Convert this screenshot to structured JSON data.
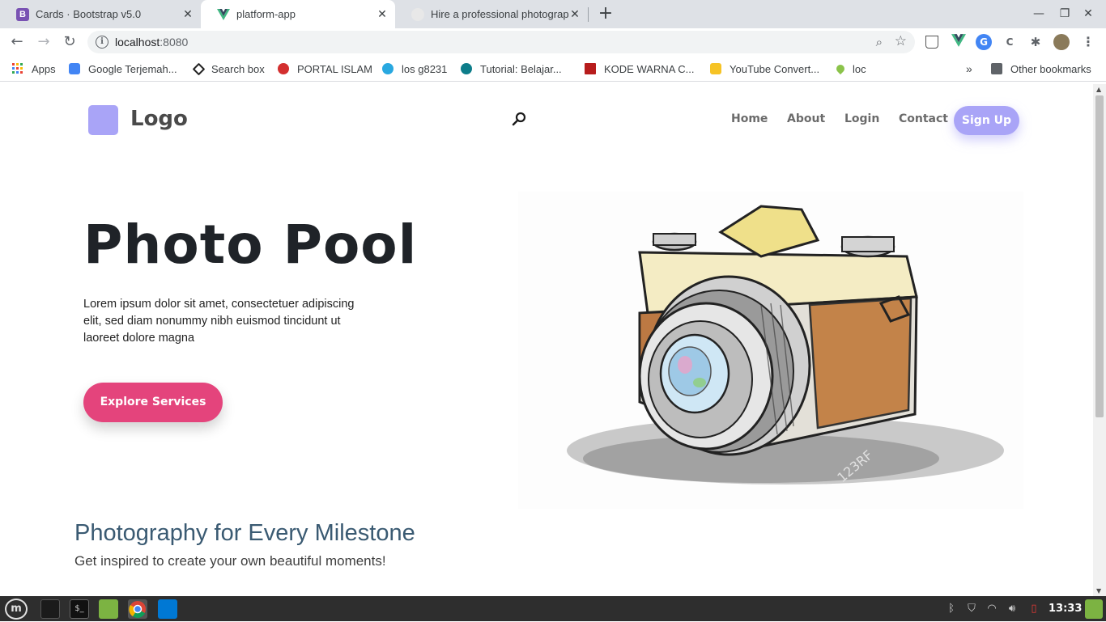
{
  "browser": {
    "tabs": [
      {
        "title": "Cards · Bootstrap v5.0",
        "favicon": "bootstrap-icon",
        "favicon_text": "B",
        "favicon_color": "#7952b3"
      },
      {
        "title": "platform-app",
        "favicon": "vue-icon",
        "active": true
      },
      {
        "title": "Hire a professional photographer",
        "favicon": "photographer-site-icon"
      }
    ],
    "new_tab_symbol": "+",
    "url_host": "localhost",
    "url_port": ":8080"
  },
  "bookmarks": [
    {
      "label": "Apps",
      "icon": "apps-grid-icon"
    },
    {
      "label": "Google Terjemah...",
      "icon": "google-translate-icon"
    },
    {
      "label": "Search box",
      "icon": "codepen-icon"
    },
    {
      "label": "PORTAL ISLAM",
      "icon": "portal-islam-icon"
    },
    {
      "label": "los g8231",
      "icon": "sf-icon"
    },
    {
      "label": "Tutorial: Belajar...",
      "icon": "tutorial-icon"
    },
    {
      "label": "KODE WARNA C...",
      "icon": "kode-warna-icon"
    },
    {
      "label": "YouTube Convert...",
      "icon": "youtube-convert-icon"
    },
    {
      "label": "loc",
      "icon": "location-icon"
    }
  ],
  "bookmarks_overflow": "»",
  "other_bookmarks": "Other bookmarks",
  "site": {
    "logo_text": "Logo",
    "nav": [
      "Home",
      "About",
      "Login",
      "Contact"
    ],
    "signup_label": "Sign Up",
    "hero_title": "Photo Pool",
    "hero_text": "Lorem ipsum dolor sit amet, consectetuer adipiscing elit, sed diam nonummy nibh euismod tincidunt ut laoreet dolore magna",
    "explore_label": "Explore Services",
    "section_title": "Photography for Every Milestone",
    "section_subtitle": "Get inspired to create your own beautiful moments!"
  },
  "taskbar": {
    "clock": "13:33"
  },
  "colors": {
    "accent_purple": "#a9a4f7",
    "accent_pink": "#e4447c",
    "section_title": "#3a5a72"
  }
}
